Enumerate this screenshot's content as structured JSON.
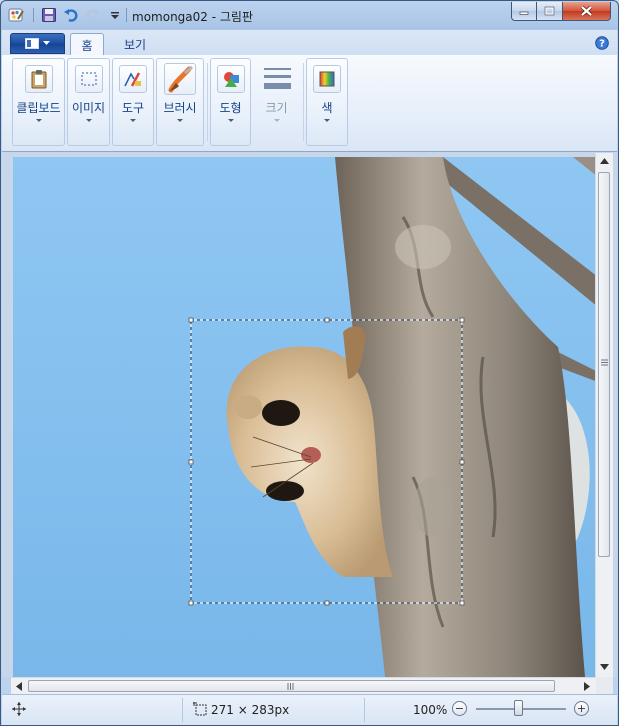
{
  "window": {
    "title": "momonga02 - 그림판",
    "controls": {
      "minimize": "minimize-button",
      "maximize": "maximize-button",
      "close": "close-button"
    }
  },
  "quick_access": {
    "icons": [
      "paint-app-icon",
      "save-icon",
      "undo-icon",
      "redo-icon",
      "customize-dropdown-icon"
    ]
  },
  "tabs": {
    "active": "홈",
    "items": [
      "홈",
      "보기"
    ]
  },
  "ribbon": {
    "groups": [
      {
        "label": "클립보드",
        "icon": "clipboard-icon",
        "enabled": true
      },
      {
        "label": "이미지",
        "icon": "select-icon",
        "enabled": true
      },
      {
        "label": "도구",
        "icon": "tools-icon",
        "enabled": true
      },
      {
        "label": "브러시",
        "icon": "brush-icon",
        "enabled": true
      },
      {
        "label": "도형",
        "icon": "shapes-icon",
        "enabled": true
      },
      {
        "label": "크기",
        "icon": "size-icon",
        "enabled": false
      },
      {
        "label": "색",
        "icon": "colors-icon",
        "enabled": true
      }
    ]
  },
  "status": {
    "selection_size": "271 × 283px",
    "zoom": "100%",
    "zoom_level": 0.5
  },
  "colors": {
    "sky": "#8cc3ef",
    "accent": "#1d4e9f",
    "close_button": "#c9412a"
  }
}
